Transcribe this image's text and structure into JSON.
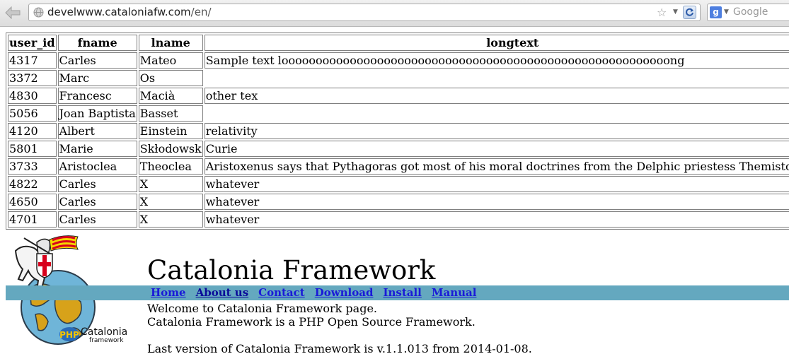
{
  "browser": {
    "url_host": "develwww.cataloniafw.com",
    "url_path": "/en/",
    "search_engine_letter": "g",
    "search_placeholder": "Google"
  },
  "table": {
    "headers": [
      "user_id",
      "fname",
      "lname",
      "longtext"
    ],
    "rows": [
      [
        "4317",
        "Carles",
        "Mateo",
        "Sample text looooooooooooooooooooooooooooooooooooooooooooooooooooooooong"
      ],
      [
        "3372",
        "Marc",
        "Os",
        ""
      ],
      [
        "4830",
        "Francesc",
        "Macià",
        "other tex"
      ],
      [
        "5056",
        "Joan Baptista",
        "Basset",
        ""
      ],
      [
        "4120",
        "Albert",
        "Einstein",
        "relativity"
      ],
      [
        "5801",
        "Marie",
        "Skłodowsk",
        "Curie"
      ],
      [
        "3733",
        "Aristoclea",
        "Theoclea",
        "Aristoxenus says that Pythagoras got most of his moral doctrines from the Delphic priestess Themistoclea."
      ],
      [
        "4822",
        "Carles",
        "X",
        "whatever"
      ],
      [
        "4650",
        "Carles",
        "X",
        "whatever"
      ],
      [
        "4701",
        "Carles",
        "X",
        "whatever"
      ]
    ]
  },
  "site": {
    "title": "Catalonia Framework",
    "logo_text": "Catalonia",
    "logo_subtext": "framework",
    "logo_badge": "PHP",
    "menu": [
      "Home",
      "About us",
      "Contact",
      "Download",
      "Install",
      "Manual"
    ],
    "active_menu": "About us",
    "content_lines": [
      "Welcome to Catalonia Framework page.",
      "Catalonia Framework is a PHP Open Source Framework.",
      "",
      "Last version of Catalonia Framework is v.1.1.013 from 2014-01-08."
    ]
  },
  "colors": {
    "menu_band": "#64a8bf",
    "link": "#1a1ad8"
  }
}
